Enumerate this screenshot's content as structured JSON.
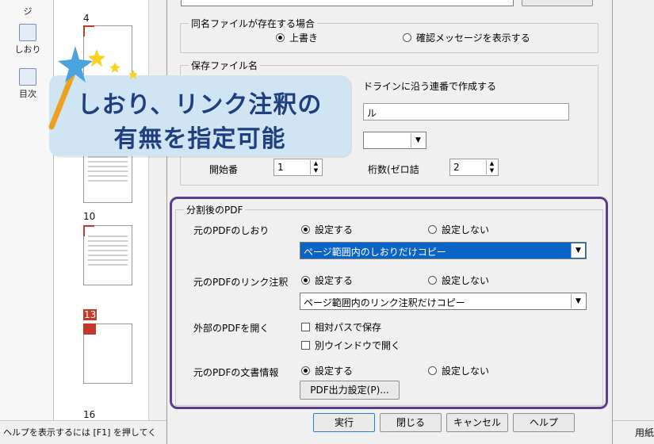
{
  "left_toolbar": {
    "items": [
      {
        "label": "ジ"
      },
      {
        "label": "しおり"
      },
      {
        "label": "目次"
      }
    ]
  },
  "thumbnails": {
    "pages": [
      "4",
      "10",
      "13",
      "16"
    ]
  },
  "status": {
    "help_text": "ヘルプを表示するには [F1] を押してく",
    "right_text": "用紙"
  },
  "dialog": {
    "same_name": {
      "legend": "同名ファイルが存在する場合",
      "overwrite": "上書き",
      "confirm": "確認メッセージを表示する"
    },
    "save_name": {
      "legend": "保存ファイル名",
      "partial_option_text": "ドラインに沿う連番で作成する",
      "partial_field_text": "ル",
      "start_label": "開始番",
      "start_value": "1",
      "digits_label": "桁数(ゼロ詰",
      "digits_value": "2"
    },
    "after_split": {
      "legend": "分割後のPDF",
      "bookmark_label": "元のPDFのしおり",
      "bookmark_set": "設定する",
      "bookmark_unset": "設定しない",
      "bookmark_select": "ページ範囲内のしおりだけコピー",
      "link_label": "元のPDFのリンク注釈",
      "link_set": "設定する",
      "link_unset": "設定しない",
      "link_select": "ページ範囲内のリンク注釈だけコピー",
      "external_label": "外部のPDFを開く",
      "relative_path": "相対パスで保存",
      "new_window": "別ウインドウで開く",
      "docinfo_label": "元のPDFの文書情報",
      "docinfo_set": "設定する",
      "docinfo_unset": "設定しない",
      "pdf_output_button": "PDF出力設定(P)..."
    },
    "buttons": {
      "run": "実行",
      "close": "閉じる",
      "cancel": "キャンセル",
      "help": "ヘルプ"
    }
  },
  "callout": {
    "line1": "しおり、リンク注釈の",
    "line2": "有無を指定可能"
  },
  "colors": {
    "highlight_border": "#5a3d8d",
    "callout_bg": "#cfe5f4",
    "callout_text": "#1f3f80",
    "selection": "#0a64c8"
  }
}
